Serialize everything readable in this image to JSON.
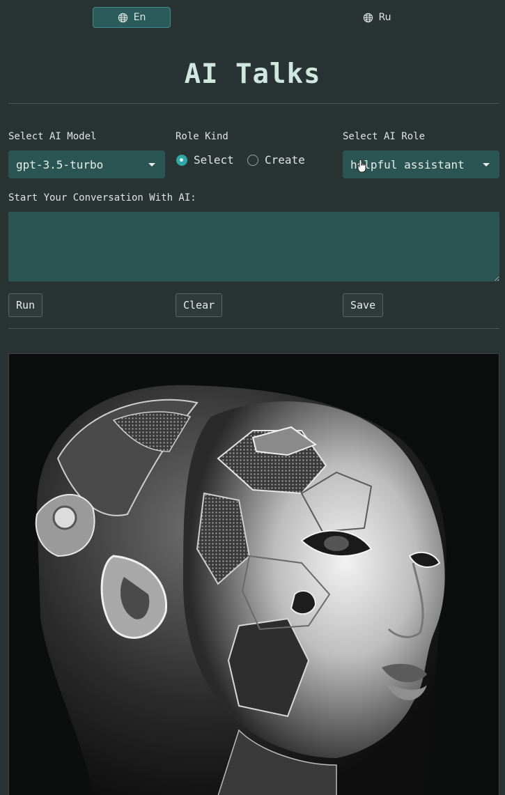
{
  "language": {
    "options": [
      {
        "label": "En",
        "icon": "globe-icon",
        "active": true
      },
      {
        "label": "Ru",
        "icon": "globe-icon",
        "active": false
      }
    ]
  },
  "header": {
    "title": "AI Talks"
  },
  "controls": {
    "model": {
      "label": "Select AI Model",
      "value": "gpt-3.5-turbo"
    },
    "role_kind": {
      "label": "Role Kind",
      "options": [
        {
          "label": "Select",
          "checked": true
        },
        {
          "label": "Create",
          "checked": false
        }
      ]
    },
    "role": {
      "label": "Select AI Role",
      "value": "helpful assistant"
    }
  },
  "conversation": {
    "label": "Start Your Conversation With AI:",
    "value": ""
  },
  "buttons": {
    "run": "Run",
    "clear": "Clear",
    "save": "Save"
  },
  "image": {
    "subject": "chrome-android-woman-portrait"
  },
  "colors": {
    "background": "#293333",
    "accent": "#2fa7a4",
    "field": "#2b5553",
    "title": "#cfe7df"
  }
}
